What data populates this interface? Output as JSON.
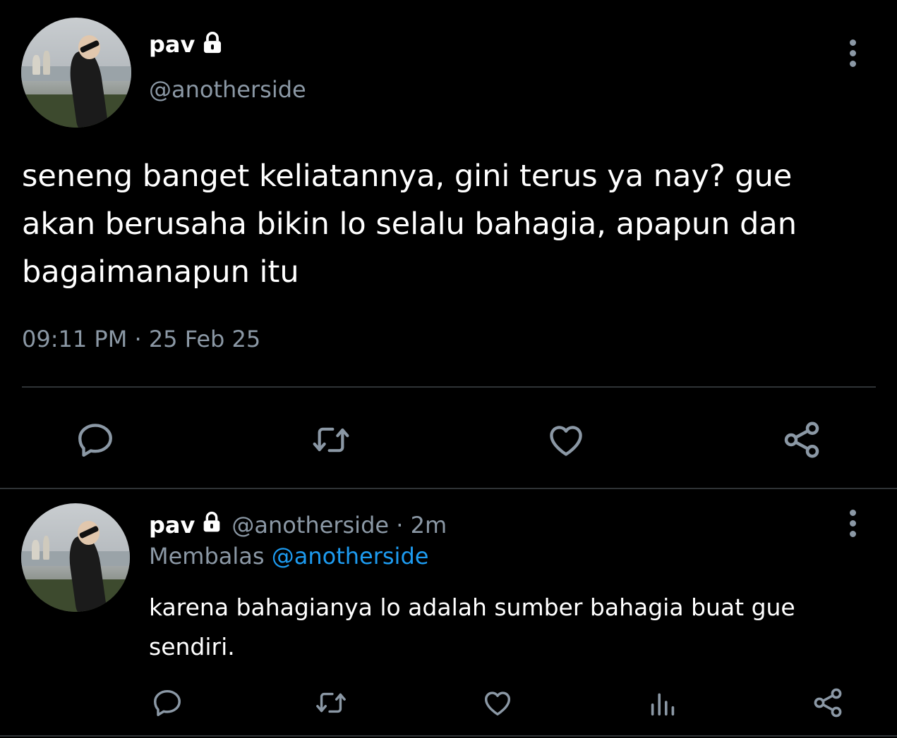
{
  "main_tweet": {
    "display_name": "pav",
    "handle": "@anotherside",
    "text": "seneng banget keliatannya, gini terus ya nay? gue akan berusaha bikin lo selalu bahagia, apapun dan bagaimanapun itu",
    "timestamp": "09:11 PM · 25 Feb 25",
    "actions": [
      "reply-icon",
      "retweet-icon",
      "like-icon",
      "share-icon"
    ]
  },
  "reply_tweet": {
    "display_name": "pav",
    "handle_time": "@anotherside · 2m",
    "replying_prefix": "Membalas",
    "replying_to": "@anotherside",
    "text": "karena bahagianya lo adalah sumber bahagia buat gue sendiri.",
    "actions": [
      "reply-icon",
      "retweet-icon",
      "like-icon",
      "analytics-icon",
      "share-icon"
    ]
  },
  "colors": {
    "background": "#000000",
    "text_primary": "#ffffff",
    "text_secondary": "#8b98a5",
    "link": "#1d9bf0",
    "divider": "#2f3336"
  }
}
